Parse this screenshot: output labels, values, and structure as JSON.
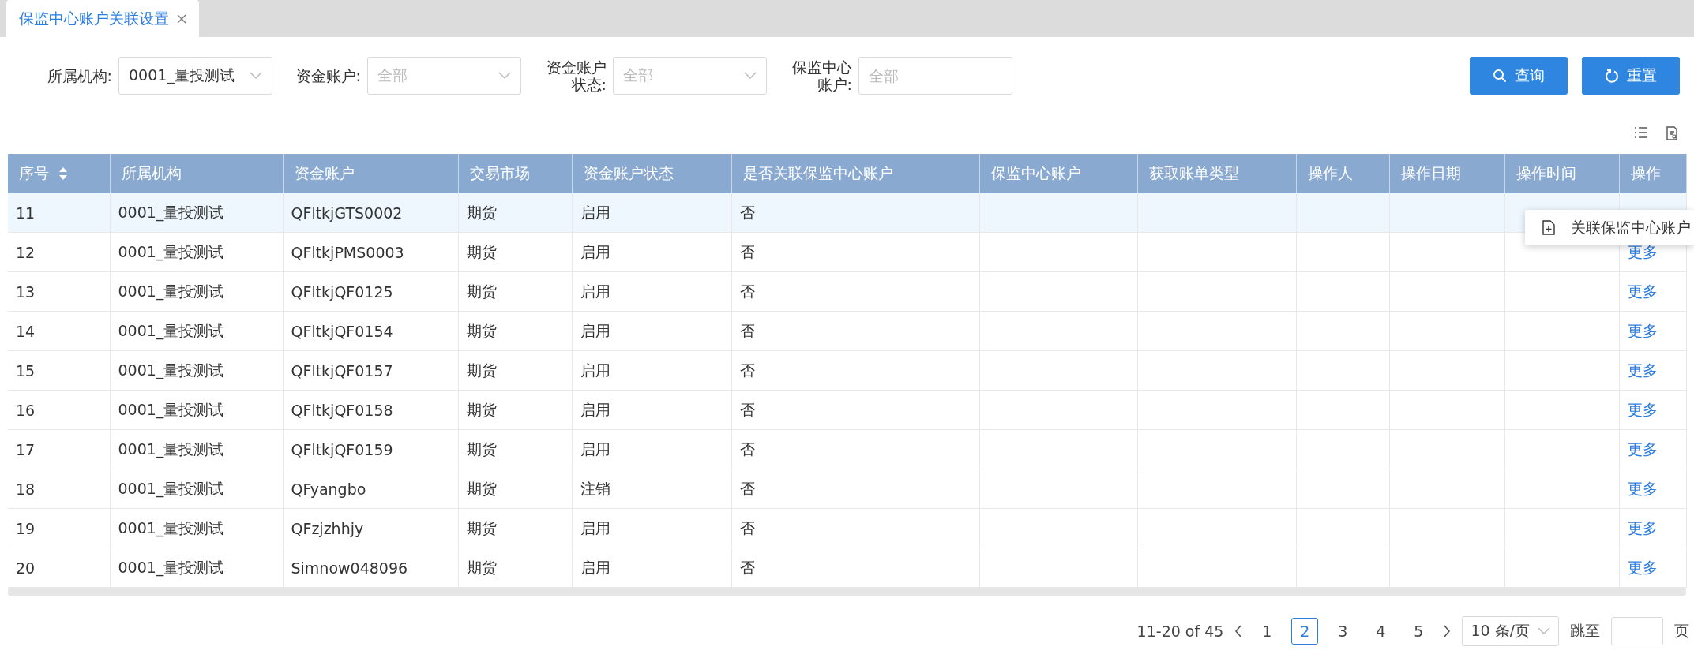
{
  "tab": {
    "label": "保监中心账户关联设置",
    "closable": true
  },
  "filters": [
    {
      "kind": "select",
      "label": "所属机构:",
      "value": "0001_量投测试"
    },
    {
      "kind": "select",
      "label": "资金账户:",
      "placeholder": "全部"
    },
    {
      "kind": "select",
      "label": "资金账户状态:",
      "placeholder": "全部"
    },
    {
      "kind": "input",
      "label": "保监中心账户:",
      "placeholder": "全部"
    }
  ],
  "buttons": [
    {
      "label": "查询",
      "kind": "search"
    },
    {
      "label": "重置",
      "kind": "reset"
    }
  ],
  "table": {
    "columns": [
      {
        "label": "序号",
        "sortable": true
      },
      {
        "label": "所属机构",
        "sortable": false
      },
      {
        "label": "资金账户",
        "sortable": false
      },
      {
        "label": "交易市场",
        "sortable": false
      },
      {
        "label": "资金账户状态",
        "sortable": false
      },
      {
        "label": "是否关联保监中心账户",
        "sortable": false
      },
      {
        "label": "保监中心账户",
        "sortable": false
      },
      {
        "label": "获取账单类型",
        "sortable": false
      },
      {
        "label": "操作人",
        "sortable": false
      },
      {
        "label": "操作日期",
        "sortable": false
      },
      {
        "label": "操作时间",
        "sortable": false
      },
      {
        "label": "操作",
        "sortable": false
      }
    ],
    "rows": [
      {
        "highlighted": true,
        "cells": [
          "11",
          "0001_量投测试",
          "QFltkjGTS0002",
          "期货",
          "启用",
          "否"
        ]
      },
      {
        "highlighted": false,
        "cells": [
          "12",
          "0001_量投测试",
          "QFltkjPMS0003",
          "期货",
          "启用",
          "否"
        ],
        "action": "更多"
      },
      {
        "highlighted": false,
        "cells": [
          "13",
          "0001_量投测试",
          "QFltkjQF0125",
          "期货",
          "启用",
          "否"
        ],
        "action": "更多"
      },
      {
        "highlighted": false,
        "cells": [
          "14",
          "0001_量投测试",
          "QFltkjQF0154",
          "期货",
          "启用",
          "否"
        ],
        "action": "更多"
      },
      {
        "highlighted": false,
        "cells": [
          "15",
          "0001_量投测试",
          "QFltkjQF0157",
          "期货",
          "启用",
          "否"
        ],
        "action": "更多"
      },
      {
        "highlighted": false,
        "cells": [
          "16",
          "0001_量投测试",
          "QFltkjQF0158",
          "期货",
          "启用",
          "否"
        ],
        "action": "更多"
      },
      {
        "highlighted": false,
        "cells": [
          "17",
          "0001_量投测试",
          "QFltkjQF0159",
          "期货",
          "启用",
          "否"
        ],
        "action": "更多"
      },
      {
        "highlighted": false,
        "cells": [
          "18",
          "0001_量投测试",
          "QFyangbo",
          "期货",
          "注销",
          "否"
        ],
        "action": "更多"
      },
      {
        "highlighted": false,
        "cells": [
          "19",
          "0001_量投测试",
          "QFzjzhhjy",
          "期货",
          "启用",
          "否"
        ],
        "action": "更多"
      },
      {
        "highlighted": false,
        "cells": [
          "20",
          "0001_量投测试",
          "Simnow048096",
          "期货",
          "启用",
          "否"
        ],
        "action": "更多"
      }
    ]
  },
  "context_menu": {
    "items": [
      {
        "label": "关联保监中心账户"
      }
    ]
  },
  "pagination": {
    "summary": "11-20 of 45",
    "pages": [
      {
        "label": "1",
        "selected": false
      },
      {
        "label": "2",
        "selected": true
      },
      {
        "label": "3",
        "selected": false
      },
      {
        "label": "4",
        "selected": false
      },
      {
        "label": "5",
        "selected": false
      }
    ],
    "page_size": "10 条/页",
    "jump_label": "跳至",
    "page_suffix": "页"
  }
}
